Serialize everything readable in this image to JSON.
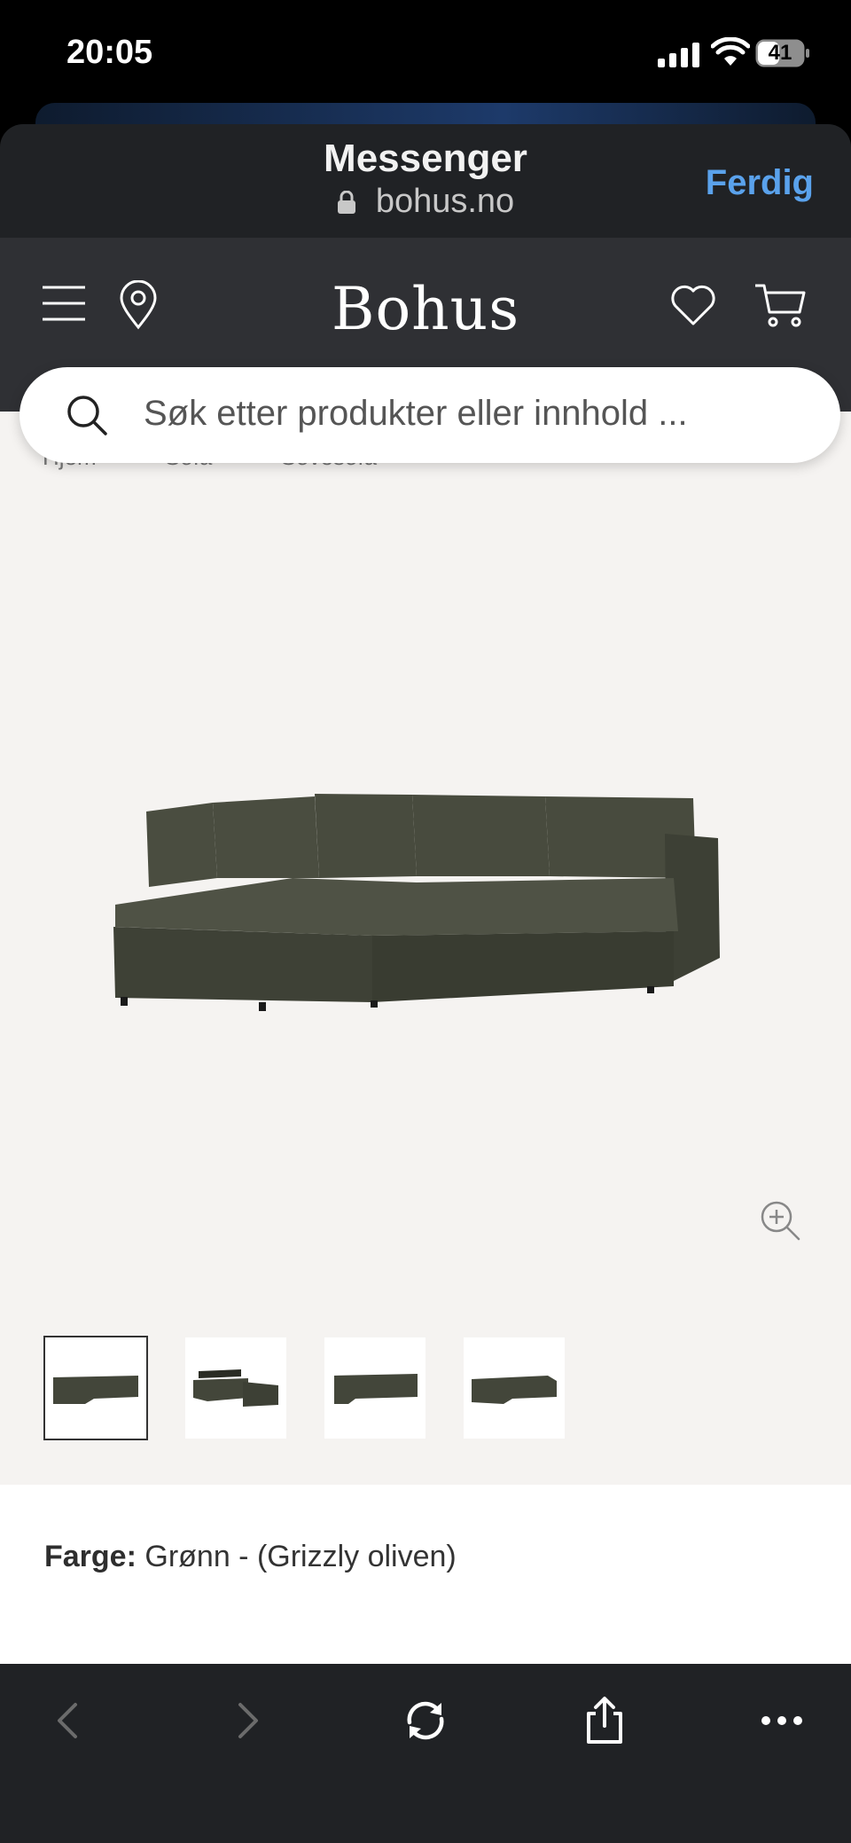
{
  "status_bar": {
    "time": "20:05",
    "battery": "41"
  },
  "browser": {
    "title": "Messenger",
    "url": "bohus.no",
    "done_label": "Ferdig"
  },
  "site": {
    "logo": "Bohus",
    "search_placeholder": "Søk etter produkter eller innhold ...",
    "icons": [
      "menu-icon",
      "location-pin-icon",
      "heart-icon",
      "cart-icon",
      "search-icon"
    ]
  },
  "breadcrumb": [
    "Hjem",
    "Sofa",
    "Sovesofa"
  ],
  "product": {
    "color_label": "Farge:",
    "color_value": "Grønn - (Grizzly oliven)",
    "image_count": 4,
    "selected_thumbnail": 1,
    "sofa_color": "#43463a"
  },
  "toolbar": {
    "icons": [
      "back-icon",
      "forward-icon",
      "reload-icon",
      "share-icon",
      "more-icon"
    ]
  }
}
